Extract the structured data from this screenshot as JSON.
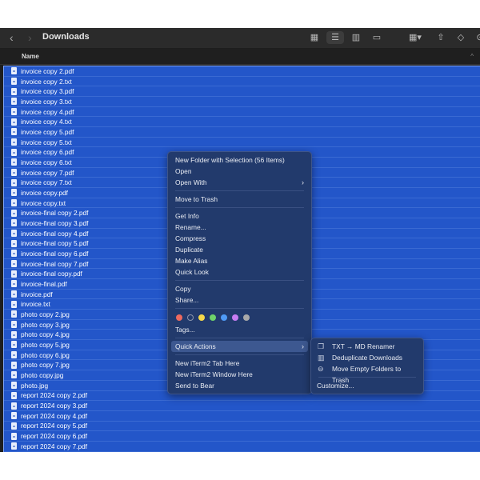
{
  "toolbar": {
    "title": "Downloads",
    "back_icon": "‹",
    "forward_icon": "›"
  },
  "header": {
    "name_label": "Name",
    "sort_icon": "^"
  },
  "files": [
    "invoice copy 2.pdf",
    "invoice copy 2.txt",
    "invoice copy 3.pdf",
    "invoice copy 3.txt",
    "invoice copy 4.pdf",
    "invoice copy 4.txt",
    "invoice copy 5.pdf",
    "invoice copy 5.txt",
    "invoice copy 6.pdf",
    "invoice copy 6.txt",
    "invoice copy 7.pdf",
    "invoice copy 7.txt",
    "invoice copy.pdf",
    "invoice copy.txt",
    "invoice-final copy 2.pdf",
    "invoice-final copy 3.pdf",
    "invoice-final copy 4.pdf",
    "invoice-final copy 5.pdf",
    "invoice-final copy 6.pdf",
    "invoice-final copy 7.pdf",
    "invoice-final copy.pdf",
    "invoice-final.pdf",
    "invoice.pdf",
    "invoice.txt",
    "photo copy 2.jpg",
    "photo copy 3.jpg",
    "photo copy 4.jpg",
    "photo copy 5.jpg",
    "photo copy 6.jpg",
    "photo copy 7.jpg",
    "photo copy.jpg",
    "photo.jpg",
    "report 2024 copy 2.pdf",
    "report 2024 copy 3.pdf",
    "report 2024 copy 4.pdf",
    "report 2024 copy 5.pdf",
    "report 2024 copy 6.pdf",
    "report 2024 copy 7.pdf"
  ],
  "menu": {
    "new_folder": "New Folder with Selection (56 Items)",
    "open": "Open",
    "open_with": "Open With",
    "move_to_trash": "Move to Trash",
    "get_info": "Get Info",
    "rename": "Rename...",
    "compress": "Compress",
    "duplicate": "Duplicate",
    "make_alias": "Make Alias",
    "quick_look": "Quick Look",
    "copy": "Copy",
    "share": "Share...",
    "tags": "Tags...",
    "quick_actions": "Quick Actions",
    "iterm_tab": "New iTerm2 Tab Here",
    "iterm_window": "New iTerm2 Window Here",
    "send_to_bear": "Send to Bear",
    "submenu_arrow": "›"
  },
  "tag_colors": [
    "#ee6a5f",
    "none",
    "#f5d94a",
    "#6fd36a",
    "#4f9bf7",
    "#c77cf2",
    "#a9a9a9"
  ],
  "submenu": {
    "txt_md": "TXT → MD Renamer",
    "dedupe": "Deduplicate Downloads",
    "move_empty": "Move Empty Folders to Trash",
    "customize": "Customize..."
  }
}
